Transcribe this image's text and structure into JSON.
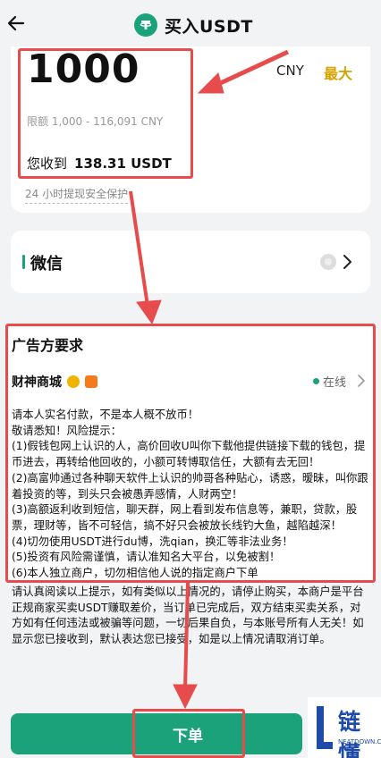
{
  "header": {
    "title": "买入USDT",
    "back_icon": "arrow-left-icon",
    "coin_icon": "tether-icon"
  },
  "amount_panel": {
    "amount_value": "1000",
    "currency": "CNY",
    "max_label": "最大",
    "limit_text": "限额 1,000 - 116,091 CNY",
    "receive_label": "您收到",
    "receive_value": "138.31 USDT",
    "safety_note": "24 小时提现安全保护"
  },
  "payment": {
    "method": "微信",
    "chevron_icon": "chevron-right-icon"
  },
  "advertiser": {
    "section_title": "广告方要求",
    "merchant_name": "财神商城",
    "status": "在线",
    "notice_lines": [
      "请本人实名付款，不是本人概不放币！",
      "敬请悉知！风险提示：",
      "(1)假钱包网上认识的人，高价回收U叫你下载他提供链接下载的钱包，提币进去，再转给他回收的，小额可转博取信任，大额有去无回！",
      "(2)高富帅通过各种聊天软件上认识的帅哥各种贴心，诱惑，暧昧，叫你跟着投资的等，到头只会被愚弄感情，人财两空！",
      "(3)高额返利收到短信，聊天群，网上看到发布信息等，兼职，贷款，股票，理财等，皆不可轻信，搞不好只会被放长线钓大鱼，越陷越深！",
      "(4)切勿使用USDT进行du博，洗qian，换汇等非法业务！",
      "(5)投资有风险需谨慎，请认准知名大平台，以免被割！",
      "(6)本人独立商户，切勿相信他人说的指定商户下单"
    ]
  },
  "disclaimer": "请认真阅读以上提示，如有类似以上情况的，请停止购买，本商户是平台正规商家买卖USDT赚取差价，当订单已完成后，双方结束买卖关系，对方如有任何违法或被骗等问题，一切后果自负，与本账号所有人无关！如显示您已接收到，默认表达您已接受，如是以上情况请取消订单。",
  "actions": {
    "submit_label": "下单"
  },
  "watermark": {
    "brand": "链懂",
    "domain": "NEATDOWN.COM"
  },
  "colors": {
    "accent": "#1ba27a",
    "max": "#d8a300",
    "highlight": "#e74c4c",
    "brand": "#1e4aa8"
  }
}
